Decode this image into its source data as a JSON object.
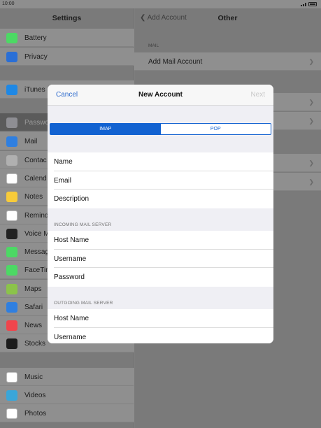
{
  "status": {
    "time": "10:00"
  },
  "settings": {
    "title": "Settings",
    "items": [
      {
        "label": "Battery",
        "icon": "battery-icon",
        "color": "#4cd964"
      },
      {
        "label": "Privacy",
        "icon": "hand-icon",
        "color": "#2a6fd6"
      },
      {
        "label": "iTunes",
        "icon": "app-store-icon",
        "color": "#1e88e5"
      },
      {
        "label": "Passwo",
        "icon": "key-icon",
        "color": "#8e8e93"
      },
      {
        "label": "Mail",
        "icon": "mail-icon",
        "color": "#2f7fe0"
      },
      {
        "label": "Contac",
        "icon": "contacts-icon",
        "color": "#b0b0b0"
      },
      {
        "label": "Calend",
        "icon": "calendar-icon",
        "color": "#ffffff"
      },
      {
        "label": "Notes",
        "icon": "notes-icon",
        "color": "#f7cb3a"
      },
      {
        "label": "Remind",
        "icon": "reminders-icon",
        "color": "#ffffff"
      },
      {
        "label": "Voice M",
        "icon": "voice-memos-icon",
        "color": "#222222"
      },
      {
        "label": "Messag",
        "icon": "messages-icon",
        "color": "#4cd964"
      },
      {
        "label": "FaceTim",
        "icon": "facetime-icon",
        "color": "#4cd964"
      },
      {
        "label": "Maps",
        "icon": "maps-icon",
        "color": "#8bc34a"
      },
      {
        "label": "Safari",
        "icon": "safari-icon",
        "color": "#2f7fe0"
      },
      {
        "label": "News",
        "icon": "news-icon",
        "color": "#f0454c"
      },
      {
        "label": "Stocks",
        "icon": "stocks-icon",
        "color": "#1c1c1c"
      },
      {
        "label": "Music",
        "icon": "music-icon",
        "color": "#ffffff"
      },
      {
        "label": "Videos",
        "icon": "videos-icon",
        "color": "#3aa6d9"
      },
      {
        "label": "Photos",
        "icon": "photos-icon",
        "color": "#ffffff"
      }
    ]
  },
  "right_panel": {
    "back_label": "Add Account",
    "title": "Other",
    "mail_section": "MAIL",
    "add_mail_account": "Add Mail Account"
  },
  "modal": {
    "cancel": "Cancel",
    "title": "New Account",
    "next": "Next",
    "segments": [
      "IMAP",
      "POP"
    ],
    "selected_segment": "IMAP",
    "account_fields": [
      "Name",
      "Email",
      "Description"
    ],
    "incoming_header": "INCOMING MAIL SERVER",
    "incoming_fields": [
      "Host Name",
      "Username",
      "Password"
    ],
    "outgoing_header": "OUTGOING MAIL SERVER",
    "outgoing_fields": [
      "Host Name",
      "Username"
    ]
  },
  "colors": {
    "accent": "#1262d1",
    "link": "#2f6ccd"
  }
}
